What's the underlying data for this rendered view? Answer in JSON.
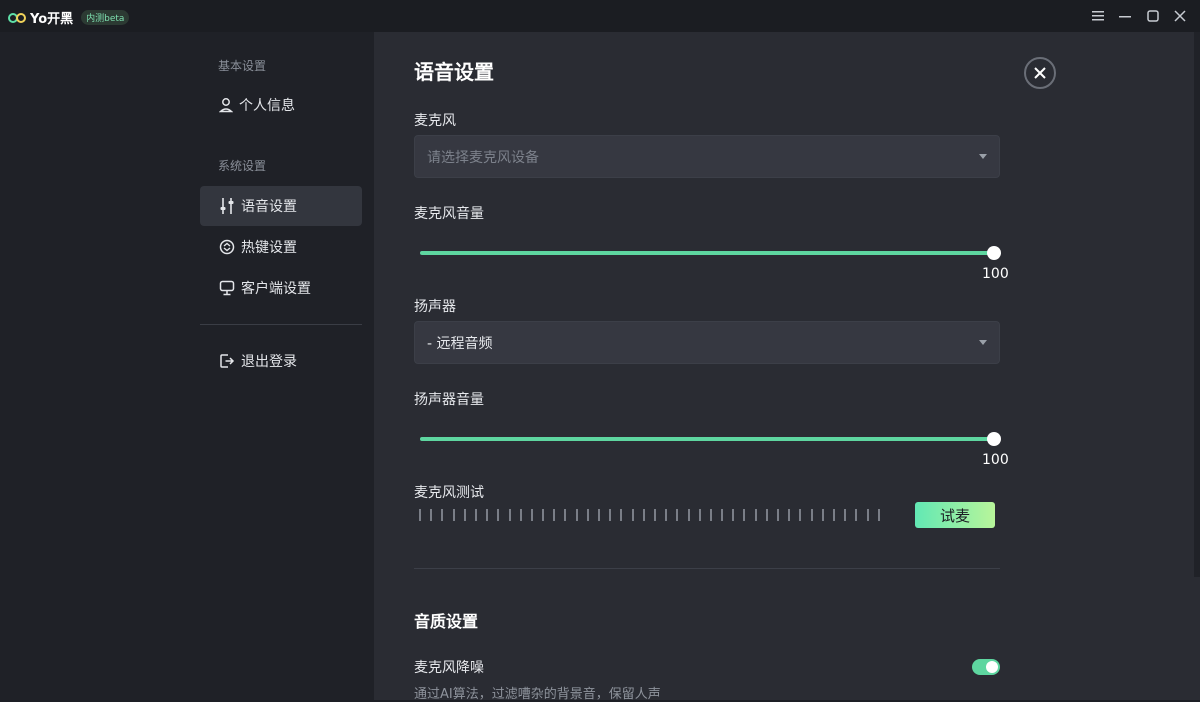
{
  "titlebar": {
    "app_name": "Yo开黑",
    "badge": "内测beta"
  },
  "sidebar": {
    "section_basic": "基本设置",
    "personal_info": "个人信息",
    "section_system": "系统设置",
    "voice_settings": "语音设置",
    "hotkey_settings": "热键设置",
    "client_settings": "客户端设置",
    "logout": "退出登录"
  },
  "main": {
    "title": "语音设置",
    "microphone": {
      "label": "麦克风",
      "placeholder": "请选择麦克风设备"
    },
    "mic_volume": {
      "label": "麦克风音量",
      "value": 100,
      "display": "100"
    },
    "speaker": {
      "label": "扬声器",
      "selected": "- 远程音频"
    },
    "speaker_volume": {
      "label": "扬声器音量",
      "value": 100,
      "display": "100"
    },
    "mic_test": {
      "label": "麦克风测试",
      "button": "试麦"
    },
    "quality": {
      "title": "音质设置",
      "noise_reduction": {
        "label": "麦克风降噪",
        "description": "通过AI算法，过滤嘈杂的背景音，保留人声",
        "enabled": true
      }
    }
  },
  "colors": {
    "accent": "#5ed6a0",
    "bg_main": "#2a2c33",
    "bg_sidebar": "#1f2127"
  }
}
